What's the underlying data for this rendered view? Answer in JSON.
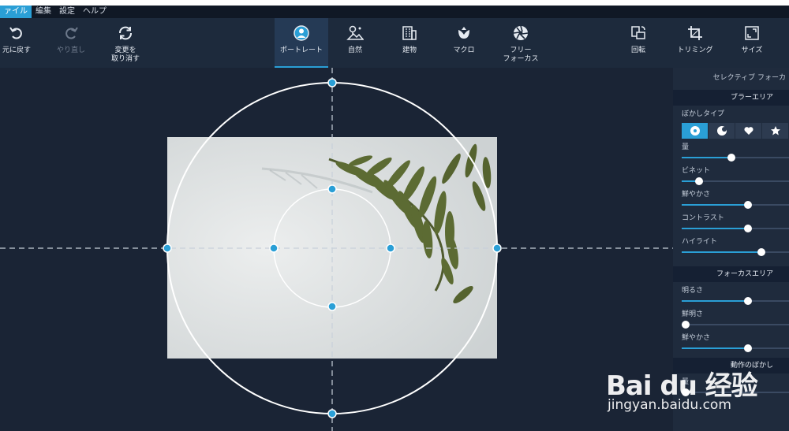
{
  "menu": {
    "items": [
      {
        "label": "ァイル",
        "active": true
      },
      {
        "label": "編集",
        "active": false
      },
      {
        "label": "設定",
        "active": false
      },
      {
        "label": "ヘルプ",
        "active": false
      }
    ]
  },
  "toolbar": {
    "undo": {
      "label": "元に戻す",
      "icon": "undo-icon"
    },
    "redo": {
      "label": "やり直し",
      "icon": "redo-icon"
    },
    "reset": {
      "label": "変更を\n取り消す",
      "icon": "reset-icon"
    },
    "portrait": {
      "label": "ポートレート",
      "icon": "portrait-icon"
    },
    "nature": {
      "label": "自然",
      "icon": "nature-icon"
    },
    "building": {
      "label": "建物",
      "icon": "building-icon"
    },
    "macro": {
      "label": "マクロ",
      "icon": "macro-icon"
    },
    "free_focus": {
      "label": "フリー\nフォーカス",
      "icon": "aperture-icon"
    },
    "rotate": {
      "label": "回転",
      "icon": "rotate-icon"
    },
    "trim": {
      "label": "トリミング",
      "icon": "crop-icon"
    },
    "size": {
      "label": "サイズ",
      "icon": "resize-icon"
    }
  },
  "panel": {
    "title": "セレクティブ フォーカ",
    "blur_area": {
      "header": "ブラーエリア",
      "blur_type_label": "ぼかしタイプ",
      "sliders": [
        {
          "label": "量",
          "value": 0.46
        },
        {
          "label": "ビネット",
          "value": 0.16
        },
        {
          "label": "鮮やかさ",
          "value": 0.62
        },
        {
          "label": "コントラスト",
          "value": 0.62
        },
        {
          "label": "ハイライト",
          "value": 0.74
        }
      ]
    },
    "focus_area": {
      "header": "フォーカスエリア",
      "sliders": [
        {
          "label": "明るさ",
          "value": 0.62
        },
        {
          "label": "鮮明さ",
          "value": 0.04
        },
        {
          "label": "鮮やかさ",
          "value": 0.62
        }
      ]
    },
    "motion_blur": {
      "header": "動作のぼかし",
      "sliders": [
        {
          "label": "量",
          "value": 0.04
        }
      ]
    }
  },
  "watermark": {
    "logo": "Bai du 经验",
    "url": "jingyan.baidu.com"
  },
  "colors": {
    "accent": "#2a9fd6",
    "background": "#1b2536",
    "panel": "#1f2b3d"
  }
}
